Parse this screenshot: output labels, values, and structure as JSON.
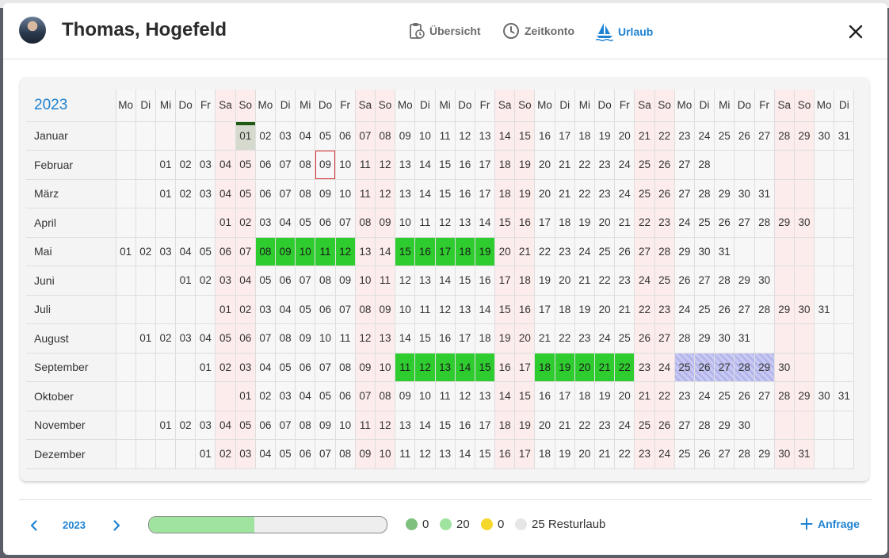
{
  "header": {
    "name": "Thomas, Hogefeld",
    "tabs": [
      {
        "label": "Übersicht",
        "icon": "clipboard-clock-icon"
      },
      {
        "label": "Zeitkonto",
        "icon": "clock-icon"
      },
      {
        "label": "Urlaub",
        "icon": "sailboat-icon",
        "active": true
      }
    ],
    "close_icon": "close-icon"
  },
  "calendar": {
    "year": "2023",
    "weekday_headers": [
      "Mo",
      "Di",
      "Mi",
      "Do",
      "Fr",
      "Sa",
      "So",
      "Mo",
      "Di",
      "Mi",
      "Do",
      "Fr",
      "Sa",
      "So",
      "Mo",
      "Di",
      "Mi",
      "Do",
      "Fr",
      "Sa",
      "So",
      "Mo",
      "Di",
      "Mi",
      "Do",
      "Fr",
      "Sa",
      "So",
      "Mo",
      "Di",
      "Mi",
      "Do",
      "Fr",
      "Sa",
      "So",
      "Mo",
      "Di"
    ],
    "months": [
      {
        "name": "Januar",
        "offset": 6,
        "days": 31
      },
      {
        "name": "Februar",
        "offset": 2,
        "days": 28
      },
      {
        "name": "März",
        "offset": 2,
        "days": 31
      },
      {
        "name": "April",
        "offset": 5,
        "days": 30
      },
      {
        "name": "Mai",
        "offset": 0,
        "days": 31
      },
      {
        "name": "Juni",
        "offset": 3,
        "days": 30
      },
      {
        "name": "Juli",
        "offset": 5,
        "days": 31
      },
      {
        "name": "August",
        "offset": 1,
        "days": 31
      },
      {
        "name": "September",
        "offset": 4,
        "days": 30
      },
      {
        "name": "Oktober",
        "offset": 6,
        "days": 31
      },
      {
        "name": "November",
        "offset": 2,
        "days": 30
      },
      {
        "name": "Dezember",
        "offset": 4,
        "days": 31
      }
    ],
    "today": {
      "month": 1,
      "day": 1
    },
    "selected": {
      "month": 2,
      "day": 9
    },
    "vacation_days": {
      "5": [
        8,
        9,
        10,
        11,
        12,
        15,
        16,
        17,
        18,
        19
      ],
      "9": [
        11,
        12,
        13,
        14,
        15,
        18,
        19,
        20,
        21,
        22
      ]
    },
    "pending_days": {
      "9": [
        25,
        26,
        27,
        28,
        29
      ]
    },
    "colors": {
      "vacation": "#2fcc2f",
      "weekend": "#fdecec",
      "pending": "#c9caf3",
      "today_marker": "#1f5a14",
      "selected_border": "#d93030"
    }
  },
  "footer": {
    "year": "2023",
    "progress_fraction": 0.444,
    "legend": [
      {
        "value": "0",
        "color": "#7fc07f"
      },
      {
        "value": "20",
        "color": "#9fe39f"
      },
      {
        "value": "0",
        "color": "#f5d82a"
      },
      {
        "value": "25 Resturlaub",
        "color": "#e6e6e6"
      }
    ],
    "request_label": "Anfrage",
    "accent": "#1e82d2"
  }
}
